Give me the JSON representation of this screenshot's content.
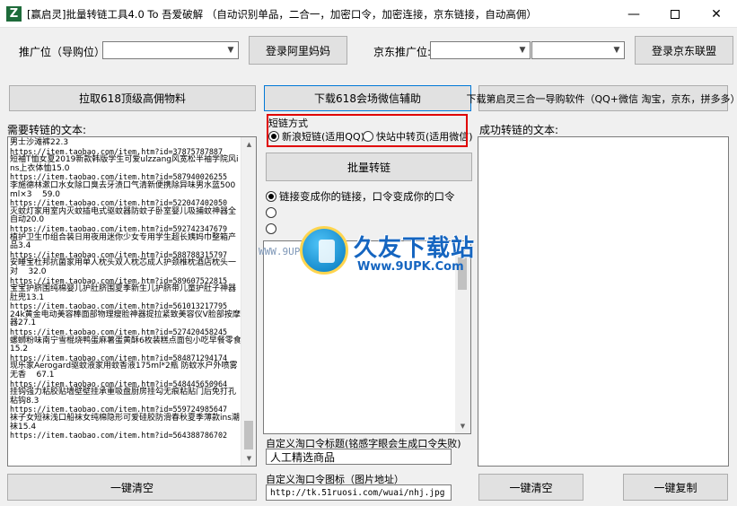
{
  "window": {
    "title": "[赢启灵]批量转链工具4.0 To 吾爱破解 （自动识别单品，二合一，加密口令，加密连接，京东链接，自动高佣）",
    "icon_letter": "Z",
    "minimize_glyph": "—",
    "close_glyph": "✕"
  },
  "top_row": {
    "promo_label": "推广位（导购位）:",
    "promo_select_1": "",
    "promo_select_2": "",
    "login_alimama": "登录阿里妈妈",
    "jd_promo_label": "京东推广位:",
    "jd_select_1": "",
    "jd_select_2": "",
    "login_jd": "登录京东联盟"
  },
  "actions": {
    "fetch_618": "拉取618顶级高佣物料",
    "download_618_helper": "下载618会场微信辅助",
    "download_3in1": "下载第启灵三合一导购软件（QQ+微信 淘宝，京东，拼多多）"
  },
  "left": {
    "label": "需要转链的文本:",
    "lines": [
      {
        "t": "男士沙滩裤22.3",
        "url": false
      },
      {
        "t": "https://item.taobao.com/item.htm?id=37875787887",
        "url": true
      },
      {
        "t": "短袖T恤女夏2019新款韩版学生可爱ulzzang风宽松半袖学院风ins上衣体恤15.0",
        "url": false
      },
      {
        "t": "https://item.taobao.com/item.htm?id=587940026255",
        "url": true
      },
      {
        "t": "李施德林漱口水女除口臭去牙渍口气清新便携除异味男水蓝500ml×3    59.0",
        "url": false
      },
      {
        "t": "https://item.taobao.com/item.htm?id=522047402050",
        "url": true
      },
      {
        "t": "灭蚊灯家用室内灭蚊插电式驱蚊器防蚊子卧室婴儿吸捕蚊神器全自动20.0",
        "url": false
      },
      {
        "t": "https://item.taobao.com/item.htm?id=592742347679",
        "url": true
      },
      {
        "t": "植护卫生巾组合装日用夜用迷你少女专用学生超长姨妈巾整箱产品3.4",
        "url": false
      },
      {
        "t": "https://item.taobao.com/item.htm?id=588788315797",
        "url": true
      },
      {
        "t": "安睡宝杜邦抗菌家用单人枕头双人枕芯成人护颈椎枕酒店枕头一对    32.0",
        "url": false
      },
      {
        "t": "https://item.taobao.com/item.htm?id=589607522815",
        "url": true
      },
      {
        "t": "宝宝护脐围纯棉婴儿护肚脐围夏季新生儿护脐带儿童护肚子神器肚兜13.1",
        "url": false
      },
      {
        "t": "https://item.taobao.com/item.htm?id=561013217795",
        "url": true
      },
      {
        "t": "24k黄金电动美容棒面部物理瘦脸神器提拉紧致美容仪V脸部按摩器27.1",
        "url": false
      },
      {
        "t": "https://item.taobao.com/item.htm?id=527420458245",
        "url": true
      },
      {
        "t": "螺蛳粉味南宁雪棍烧鸭蛋麻薯蛋黄酥6枚装糕点面包小吃早餐零食    15.2",
        "url": false
      },
      {
        "t": "https://item.taobao.com/item.htm?id=584871294174",
        "url": true
      },
      {
        "t": "现乐家Aerogard驱蚊液家用蚊香液175ml*2瓶 防蚊水户外喷雾无香    67.1",
        "url": false
      },
      {
        "t": "https://item.taobao.com/item.htm?id=548445650964",
        "url": true
      },
      {
        "t": "挂钩强力粘胶贴墙壁壁挂承重吸盘厨房挂勾无痕粘贴门后免打孔粘钩8.3",
        "url": false
      },
      {
        "t": "https://item.taobao.com/item.htm?id=559724985647",
        "url": true
      },
      {
        "t": "袜子女短袜浅口船袜女纯棉隐形可爱硅胶防滑春秋夏季薄款ins潮袜15.4",
        "url": false
      },
      {
        "t": "https://item.taobao.com/item.htm?id=564388786702",
        "url": true
      }
    ],
    "clear_button": "一键清空"
  },
  "middle": {
    "mode_label": "短链方式",
    "mode_options": [
      "新浪短链(适用QQ)",
      "快站中转页(适用微信)"
    ],
    "mode_selected": 0,
    "batch_convert": "批量转链",
    "link_option": "链接变成你的链接，口令变成你的口令",
    "custom_title_label": "自定义淘口令标题(铭感字眼会生成口令失败)",
    "custom_title_value": "人工精选商品",
    "custom_icon_label": "自定义淘口令图标（图片地址）",
    "custom_icon_value": "http://tk.51ruosi.com/wuai/nhj.jpg"
  },
  "watermark": {
    "brand": "久友下载站",
    "url": "Www.9UPK.Com",
    "side": "WWW.9UPK.COM"
  },
  "right": {
    "label": "成功转链的文本:",
    "output": "",
    "clear_button": "一键清空",
    "copy_button": "一键复制"
  },
  "colors": {
    "highlight_red": "#e00000",
    "focus_blue": "#0078d7",
    "watermark_blue": "#1565c0"
  }
}
